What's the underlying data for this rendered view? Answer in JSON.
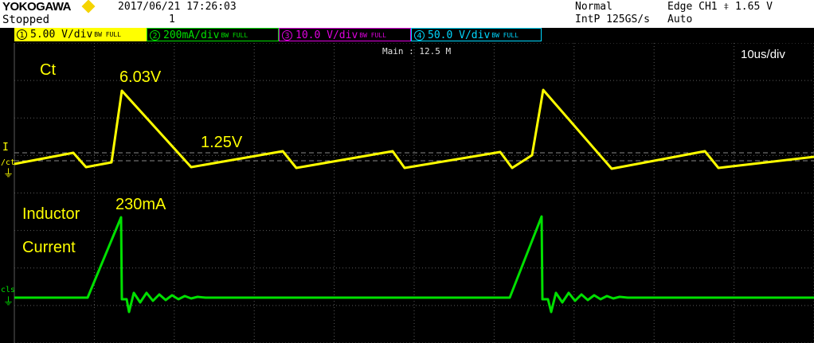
{
  "header": {
    "brand": "YOKOGAWA",
    "status": "Stopped",
    "record_count": "1",
    "timestamp": "2017/06/21 17:26:03",
    "acq_mode": "Normal",
    "sample_rate": "IntP 125GS/s",
    "trigger": "Edge CH1 ⧧ 1.65 V",
    "trigger_mode": "Auto"
  },
  "channels": [
    {
      "num": "1",
      "scale": "5.00 V/div",
      "bw": "BW FULL",
      "color": "#ffff00"
    },
    {
      "num": "2",
      "scale": "200mA/div",
      "bw": "BW FULL",
      "color": "#00e000"
    },
    {
      "num": "3",
      "scale": "10.0 V/div",
      "bw": "BW FULL",
      "color": "#e000e0"
    },
    {
      "num": "4",
      "scale": "50.0 V/div",
      "bw": "BW FULL",
      "color": "#00d8ff"
    }
  ],
  "screen": {
    "timebase_label": "Main : 12.5 M",
    "time_div": "10us/div",
    "trigger_level_marker": "I",
    "ch1_marker": "/ct",
    "ch2_marker": "cls"
  },
  "annotations": {
    "ct_label": "Ct",
    "peak_voltage": "6.03V",
    "valley_voltage": "1.25V",
    "peak_current": "230mA",
    "inductor_label": "Inductor",
    "current_label": "Current"
  },
  "colors": {
    "ch1": "#ffff00",
    "ch2": "#00e000",
    "grid": "#5a5a5a",
    "background": "#000000"
  }
}
